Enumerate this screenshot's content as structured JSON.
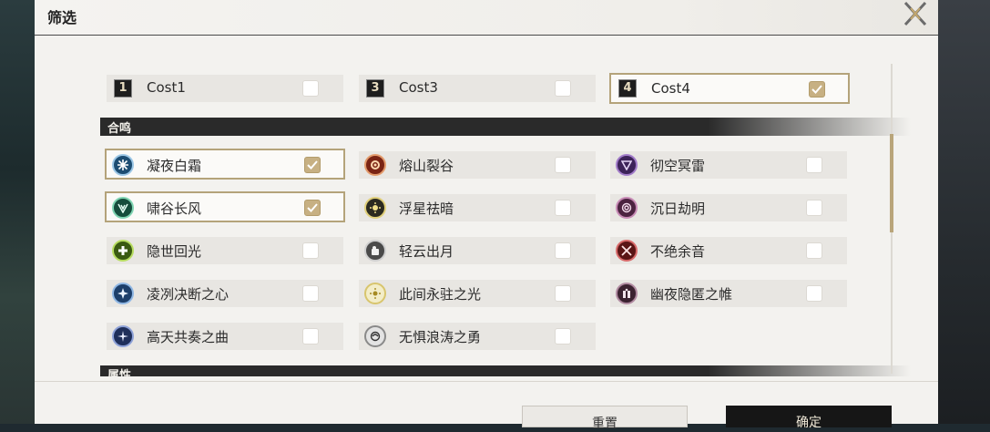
{
  "header": {
    "title": "筛选"
  },
  "costs": [
    {
      "badge": "1",
      "label": "Cost1",
      "checked": false
    },
    {
      "badge": "3",
      "label": "Cost3",
      "checked": false
    },
    {
      "badge": "4",
      "label": "Cost4",
      "checked": true
    }
  ],
  "sections": {
    "sonata": "合鸣",
    "attribute": "属性"
  },
  "sonata_items": [
    {
      "label": "凝夜白霜",
      "icon": "frost-icon",
      "checked": true
    },
    {
      "label": "熔山裂谷",
      "icon": "flame-icon",
      "checked": false
    },
    {
      "label": "彻空冥雷",
      "icon": "thunder-icon",
      "checked": false
    },
    {
      "label": "啸谷长风",
      "icon": "wind-icon",
      "checked": true
    },
    {
      "label": "浮星祛暗",
      "icon": "star-icon",
      "checked": false
    },
    {
      "label": "沉日劫明",
      "icon": "swirl-icon",
      "checked": false
    },
    {
      "label": "隐世回光",
      "icon": "heal-icon",
      "checked": false
    },
    {
      "label": "轻云出月",
      "icon": "cloud-icon",
      "checked": false
    },
    {
      "label": "不绝余音",
      "icon": "swords-icon",
      "checked": false
    },
    {
      "label": "凌冽决断之心",
      "icon": "frost-star-icon",
      "checked": false
    },
    {
      "label": "此间永驻之光",
      "icon": "sun-icon",
      "checked": false
    },
    {
      "label": "幽夜隐匿之帷",
      "icon": "veil-icon",
      "checked": false
    },
    {
      "label": "高天共奏之曲",
      "icon": "sky-icon",
      "checked": false
    },
    {
      "label": "无惧浪涛之勇",
      "icon": "wave-icon",
      "checked": false
    }
  ],
  "buttons": {
    "reset": "重置",
    "confirm": "确定"
  },
  "colors": {
    "accent": "#c7b083",
    "panel": "#f3f2ef",
    "section": "#2a2a2a"
  }
}
